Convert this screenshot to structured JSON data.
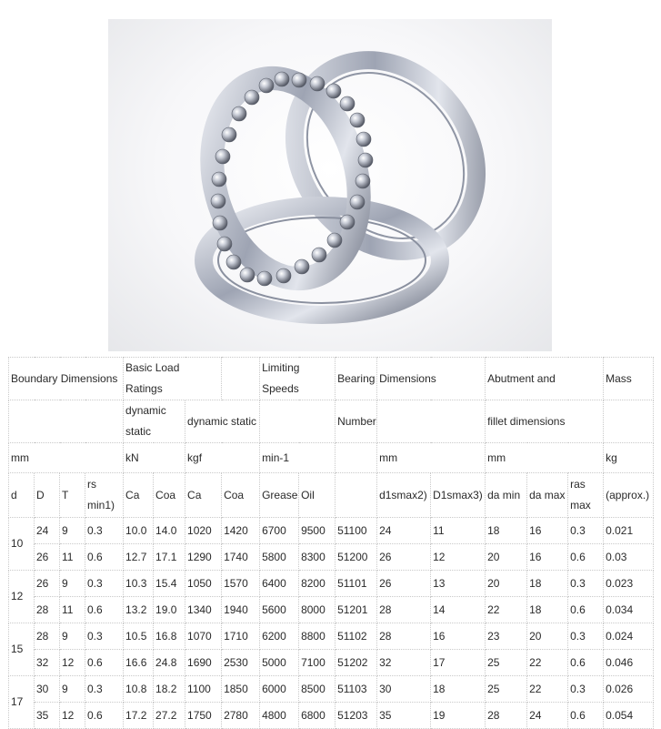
{
  "header": {
    "boundary": "Boundary Dimensions",
    "basic_load": "Basic Load Ratings",
    "limiting": "Limiting Speeds",
    "bearing": "Bearing",
    "dimensions": "Dimensions",
    "abutment": "Abutment and",
    "mass": "Mass",
    "dynamic_static_kn": "dynamic static",
    "dynamic_static_kgf": "dynamic static",
    "number": "Number",
    "fillet": "fillet dimensions"
  },
  "units": {
    "mm": "mm",
    "kn": "kN",
    "kgf": "kgf",
    "speed": "min-1",
    "dims_mm": "mm",
    "abut_mm": "mm",
    "kg": "kg"
  },
  "columns": [
    "d",
    "D",
    "T",
    "rs min1)",
    "Ca",
    "Coa",
    "Ca",
    "Coa",
    "Grease",
    "Oil",
    "",
    "d1smax2)",
    "D1smax3)",
    "da min",
    "da max",
    "ras max",
    "(approx.)"
  ],
  "groups": [
    {
      "d": "10",
      "rows": [
        [
          "24",
          "9",
          "0.3",
          "10.0",
          "14.0",
          "1020",
          "1420",
          "6700",
          "9500",
          "51100",
          "24",
          "11",
          "18",
          "16",
          "0.3",
          "0.021"
        ],
        [
          "26",
          "11",
          "0.6",
          "12.7",
          "17.1",
          "1290",
          "1740",
          "5800",
          "8300",
          "51200",
          "26",
          "12",
          "20",
          "16",
          "0.6",
          "0.03"
        ]
      ]
    },
    {
      "d": "12",
      "rows": [
        [
          "26",
          "9",
          "0.3",
          "10.3",
          "15.4",
          "1050",
          "1570",
          "6400",
          "8200",
          "51101",
          "26",
          "13",
          "20",
          "18",
          "0.3",
          "0.023"
        ],
        [
          "28",
          "11",
          "0.6",
          "13.2",
          "19.0",
          "1340",
          "1940",
          "5600",
          "8000",
          "51201",
          "28",
          "14",
          "22",
          "18",
          "0.6",
          "0.034"
        ]
      ]
    },
    {
      "d": "15",
      "rows": [
        [
          "28",
          "9",
          "0.3",
          "10.5",
          "16.8",
          "1070",
          "1710",
          "6200",
          "8800",
          "51102",
          "28",
          "16",
          "23",
          "20",
          "0.3",
          "0.024"
        ],
        [
          "32",
          "12",
          "0.6",
          "16.6",
          "24.8",
          "1690",
          "2530",
          "5000",
          "7100",
          "51202",
          "32",
          "17",
          "25",
          "22",
          "0.6",
          "0.046"
        ]
      ]
    },
    {
      "d": "17",
      "rows": [
        [
          "30",
          "9",
          "0.3",
          "10.8",
          "18.2",
          "1100",
          "1850",
          "6000",
          "8500",
          "51103",
          "30",
          "18",
          "25",
          "22",
          "0.3",
          "0.026"
        ],
        [
          "35",
          "12",
          "0.6",
          "17.2",
          "27.2",
          "1750",
          "2780",
          "4800",
          "6800",
          "51203",
          "35",
          "19",
          "28",
          "24",
          "0.6",
          "0.054"
        ]
      ]
    }
  ]
}
